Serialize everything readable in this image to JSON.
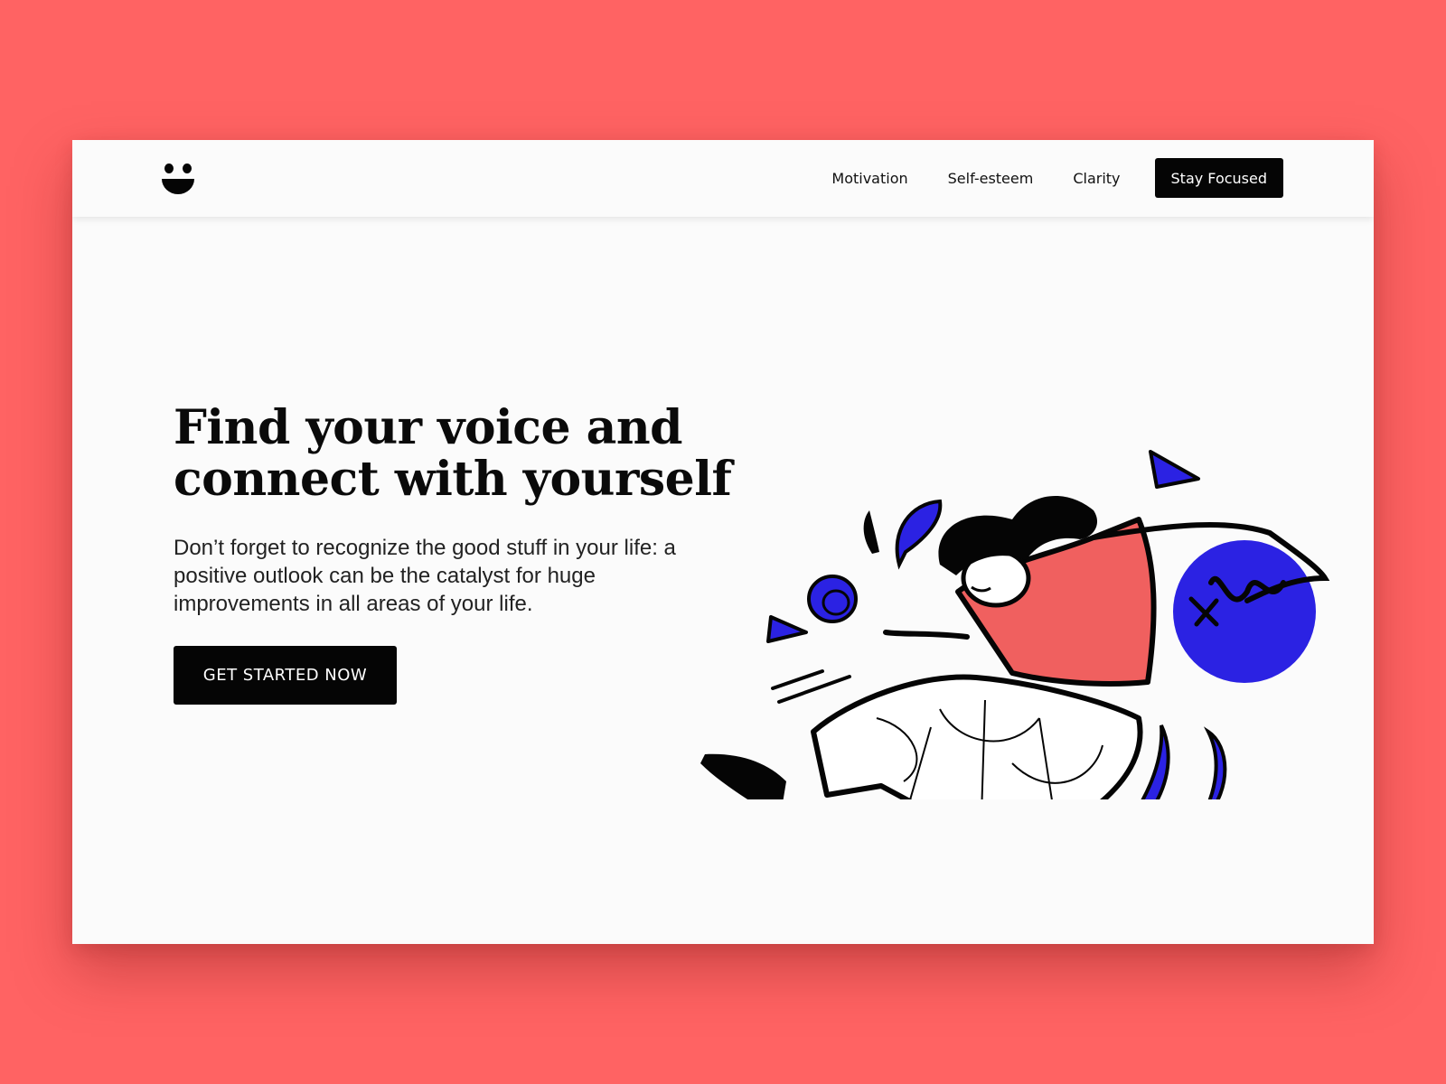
{
  "colors": {
    "background": "#ff6363",
    "page": "#fbfbfb",
    "ink": "#050505",
    "accent_blue": "#2b22e3",
    "accent_coral": "#f0605f"
  },
  "navbar": {
    "logo_icon": "smiley-face-icon",
    "links": [
      "Motivation",
      "Self-esteem",
      "Clarity"
    ],
    "cta_label": "Stay Focused"
  },
  "hero": {
    "title": "Find your voice and connect with yourself",
    "subtitle": "Don’t forget to recognize the good stuff in your life: a positive outlook can be the catalyst for huge improvements in all areas of your life.",
    "cta_label": "GET STARTED NOW"
  },
  "illustration": {
    "icon": "floating-woman-with-ball-illustration"
  }
}
